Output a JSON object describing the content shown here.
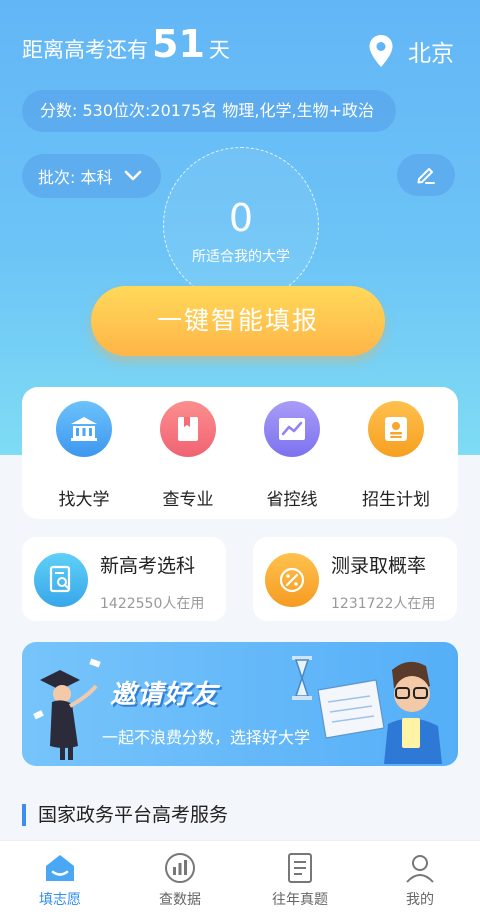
{
  "header": {
    "countdown_prefix": "距离高考还有",
    "countdown_days": "51",
    "countdown_suffix": "天",
    "city": "北京"
  },
  "profile": {
    "score_line": "分数: 530位次:20175名 物理,化学,生物+政治",
    "batch_label": "批次: 本科"
  },
  "match": {
    "count": "0",
    "label": "所适合我的大学"
  },
  "cta_label": "一键智能填报",
  "quick_links": [
    {
      "label": "找大学",
      "icon": "university-icon",
      "color": "#4aa7f4"
    },
    {
      "label": "查专业",
      "icon": "book-icon",
      "color": "#f56e77"
    },
    {
      "label": "省控线",
      "icon": "chart-line-icon",
      "color": "#8f84f3"
    },
    {
      "label": "招生计划",
      "icon": "id-card-icon",
      "color": "#f6a829"
    }
  ],
  "features": [
    {
      "title": "新高考选科",
      "sub": "1422550人在用",
      "icon": "document-search-icon",
      "color": "#47b3ee"
    },
    {
      "title": "测录取概率",
      "sub": "1231722人在用",
      "icon": "percent-icon",
      "color": "#f6a429"
    }
  ],
  "banner": {
    "title": "邀请好友",
    "subtitle": "一起不浪费分数，选择好大学"
  },
  "section_title": "国家政务平台高考服务",
  "tabs": [
    {
      "label": "填志愿",
      "icon": "home-icon",
      "active": true
    },
    {
      "label": "查数据",
      "icon": "data-chart-icon",
      "active": false
    },
    {
      "label": "往年真题",
      "icon": "exam-paper-icon",
      "active": false
    },
    {
      "label": "我的",
      "icon": "user-icon",
      "active": false
    }
  ],
  "colors": {
    "accent": "#2f8cf0",
    "cta": "#ffc14f"
  }
}
